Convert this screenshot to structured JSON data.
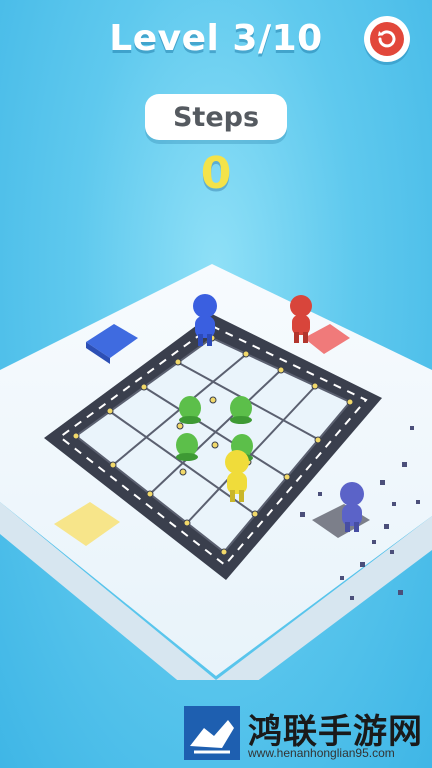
{
  "header": {
    "level_title": "Level 3/10",
    "restart_icon": "restart-icon",
    "accent_color": "#e2473a"
  },
  "score": {
    "steps_label": "Steps",
    "steps_value": "0",
    "value_color": "#f4e34a"
  },
  "game": {
    "grid_size": "4x4",
    "characters": [
      "blue",
      "red",
      "yellow",
      "purple"
    ],
    "targets": [
      "blue",
      "red",
      "yellow",
      "purple"
    ],
    "obstacles": "4 green bushes"
  },
  "watermark": {
    "name": "鸿联手游网",
    "url": "www.henanhonglian95.com"
  }
}
